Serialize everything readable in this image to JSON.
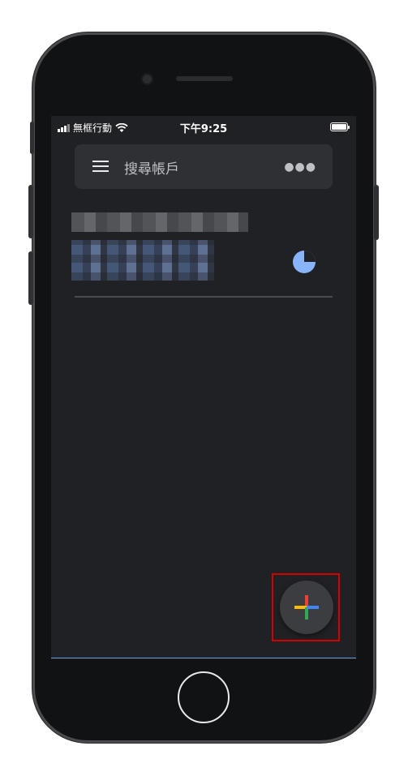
{
  "statusbar": {
    "carrier": "無框行動",
    "time": "下午9:25"
  },
  "search": {
    "placeholder": "搜尋帳戶"
  },
  "icons": {
    "menu": "menu-icon",
    "more": "more-icon",
    "timer": "timer-icon",
    "add": "add-icon",
    "wifi": "wifi-icon",
    "signal": "signal-icon",
    "battery": "battery-icon"
  },
  "colors": {
    "screen_bg": "#202124",
    "searchbar_bg": "#2f3033",
    "accent_blue": "#8ab4f8",
    "fab_bg": "#3c3d40",
    "highlight": "#d50000",
    "plus_red": "#ea4335",
    "plus_yellow": "#fbbc04",
    "plus_green": "#34a853",
    "plus_blue": "#4285f4"
  },
  "timer": {
    "remaining_fraction": 0.75
  }
}
